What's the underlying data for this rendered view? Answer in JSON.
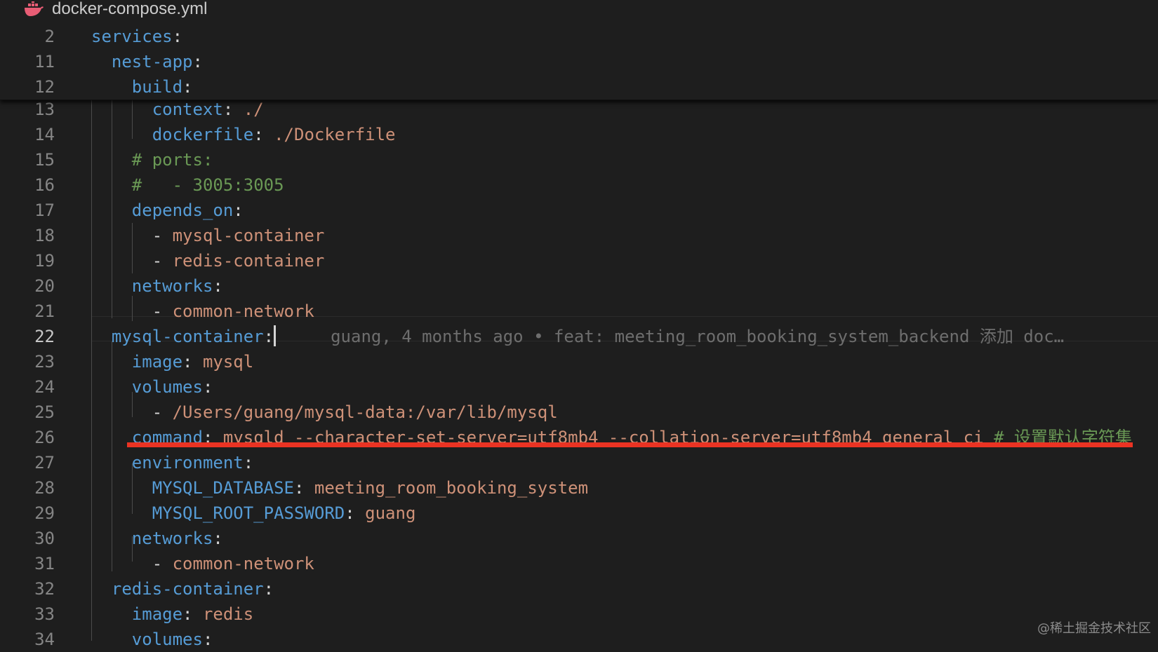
{
  "tab": {
    "title": "docker-compose.yml",
    "icon": "docker-whale-icon",
    "icon_color": "#e85d75"
  },
  "sticky_lines": [
    {
      "num": "2",
      "tokens": [
        {
          "t": "services",
          "c": "k"
        },
        {
          "t": ":",
          "c": "p"
        }
      ]
    },
    {
      "num": "11",
      "tokens": [
        {
          "t": "nest-app",
          "c": "k"
        },
        {
          "t": ":",
          "c": "p"
        }
      ]
    },
    {
      "num": "12",
      "tokens": [
        {
          "t": "build",
          "c": "k"
        },
        {
          "t": ":",
          "c": "p"
        }
      ]
    }
  ],
  "lines": [
    {
      "num": "13",
      "tokens": [
        {
          "t": "context",
          "c": "k"
        },
        {
          "t": ": ",
          "c": "p"
        },
        {
          "t": "./",
          "c": "v"
        }
      ]
    },
    {
      "num": "14",
      "tokens": [
        {
          "t": "dockerfile",
          "c": "k"
        },
        {
          "t": ": ",
          "c": "p"
        },
        {
          "t": "./Dockerfile",
          "c": "v"
        }
      ]
    },
    {
      "num": "15",
      "tokens": [
        {
          "t": "# ports:",
          "c": "c"
        }
      ]
    },
    {
      "num": "16",
      "tokens": [
        {
          "t": "#   - 3005:3005",
          "c": "c"
        }
      ]
    },
    {
      "num": "17",
      "tokens": [
        {
          "t": "depends_on",
          "c": "k"
        },
        {
          "t": ":",
          "c": "p"
        }
      ]
    },
    {
      "num": "18",
      "tokens": [
        {
          "t": "- ",
          "c": "p"
        },
        {
          "t": "mysql-container",
          "c": "v"
        }
      ]
    },
    {
      "num": "19",
      "tokens": [
        {
          "t": "- ",
          "c": "p"
        },
        {
          "t": "redis-container",
          "c": "v"
        }
      ]
    },
    {
      "num": "20",
      "tokens": [
        {
          "t": "networks",
          "c": "k"
        },
        {
          "t": ":",
          "c": "p"
        }
      ]
    },
    {
      "num": "21",
      "tokens": [
        {
          "t": "- ",
          "c": "p"
        },
        {
          "t": "common-network",
          "c": "v"
        }
      ]
    },
    {
      "num": "22",
      "active": true,
      "tokens": [
        {
          "t": "mysql-container",
          "c": "k"
        },
        {
          "t": ":",
          "c": "p"
        }
      ],
      "blame": "guang, 4 months ago • feat: meeting_room_booking_system_backend 添加 doc…"
    },
    {
      "num": "23",
      "tokens": [
        {
          "t": "image",
          "c": "k"
        },
        {
          "t": ": ",
          "c": "p"
        },
        {
          "t": "mysql",
          "c": "v"
        }
      ]
    },
    {
      "num": "24",
      "tokens": [
        {
          "t": "volumes",
          "c": "k"
        },
        {
          "t": ":",
          "c": "p"
        }
      ]
    },
    {
      "num": "25",
      "tokens": [
        {
          "t": "- ",
          "c": "p"
        },
        {
          "t": "/Users/guang/mysql-data:/var/lib/mysql",
          "c": "v"
        }
      ]
    },
    {
      "num": "26",
      "tokens": [
        {
          "t": "command",
          "c": "k"
        },
        {
          "t": ": ",
          "c": "p"
        },
        {
          "t": "mysqld --character-set-server=utf8mb4 --collation-server=utf8mb4_general_ci",
          "c": "v"
        },
        {
          "t": " # 设置默认字符集",
          "c": "c"
        }
      ]
    },
    {
      "num": "27",
      "tokens": [
        {
          "t": "environment",
          "c": "k"
        },
        {
          "t": ":",
          "c": "p"
        }
      ]
    },
    {
      "num": "28",
      "tokens": [
        {
          "t": "MYSQL_DATABASE",
          "c": "k"
        },
        {
          "t": ": ",
          "c": "p"
        },
        {
          "t": "meeting_room_booking_system",
          "c": "v"
        }
      ]
    },
    {
      "num": "29",
      "tokens": [
        {
          "t": "MYSQL_ROOT_PASSWORD",
          "c": "k"
        },
        {
          "t": ": ",
          "c": "p"
        },
        {
          "t": "guang",
          "c": "v"
        }
      ]
    },
    {
      "num": "30",
      "tokens": [
        {
          "t": "networks",
          "c": "k"
        },
        {
          "t": ":",
          "c": "p"
        }
      ]
    },
    {
      "num": "31",
      "tokens": [
        {
          "t": "- ",
          "c": "p"
        },
        {
          "t": "common-network",
          "c": "v"
        }
      ]
    },
    {
      "num": "32",
      "tokens": [
        {
          "t": "redis-container",
          "c": "k"
        },
        {
          "t": ":",
          "c": "p"
        }
      ]
    },
    {
      "num": "33",
      "tokens": [
        {
          "t": "image",
          "c": "k"
        },
        {
          "t": ": ",
          "c": "p"
        },
        {
          "t": "redis",
          "c": "v"
        }
      ]
    },
    {
      "num": "34",
      "tokens": [
        {
          "t": "volumes",
          "c": "k"
        },
        {
          "t": ":",
          "c": "p"
        }
      ]
    }
  ],
  "annotation": {
    "color": "#ea3323"
  },
  "watermark": "@稀土掘金技术社区"
}
